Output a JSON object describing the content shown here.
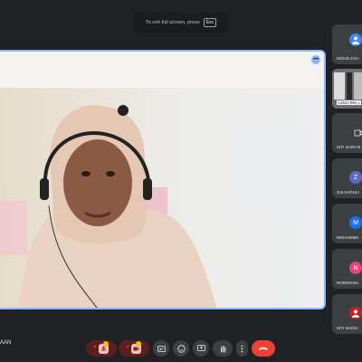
{
  "fullscreen_hint": {
    "text": "To exit full screen, press",
    "key": "Esc"
  },
  "self_name": "AAN",
  "participants": [
    {
      "name": "MOHD ZAH",
      "avatar_letter": "",
      "avatar_color": "#4285f4"
    },
    {
      "name": "AZMA BIN L",
      "avatar_letter": "",
      "avatar_color": ""
    },
    {
      "name": "SITI SARA B",
      "avatar_letter": "",
      "avatar_color": ""
    },
    {
      "name": "ZULFADHLI",
      "avatar_letter": "Z",
      "avatar_color": "#5c6bc0"
    },
    {
      "name": "MOHAMMA",
      "avatar_letter": "M",
      "avatar_color": "#1a73e8"
    },
    {
      "name": "NORDIANA",
      "avatar_letter": "N",
      "avatar_color": "#e8437a"
    },
    {
      "name": "SITI NADIA",
      "avatar_letter": "",
      "avatar_color": "#c5221f"
    }
  ],
  "colors": {
    "accent": "#8ab4f8",
    "end_call": "#ea4335",
    "muted_bg": "#5c1f1f"
  }
}
